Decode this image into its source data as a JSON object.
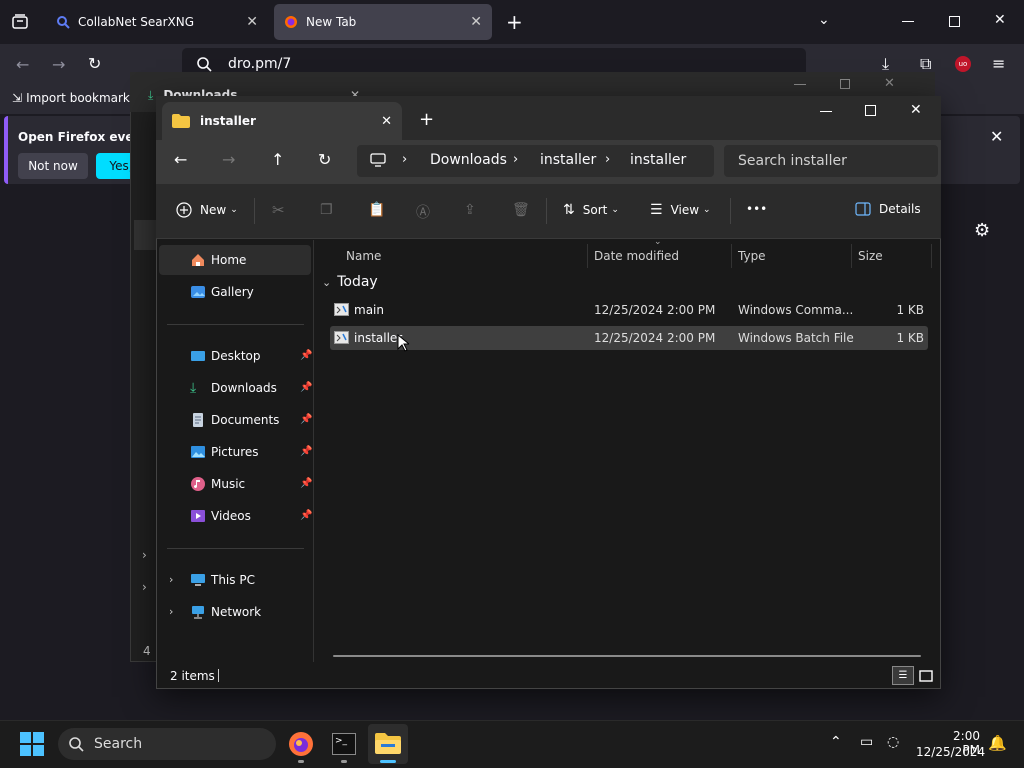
{
  "firefox": {
    "tabs": [
      {
        "label": "CollabNet SearXNG"
      },
      {
        "label": "New Tab"
      }
    ],
    "url": "dro.pm/7",
    "bookmarks": {
      "import_label": "Import bookmarks"
    },
    "notification": {
      "text": "Open Firefox every",
      "not_now": "Not now",
      "yes": "Yes,"
    },
    "side_text": "4"
  },
  "bg_window": {
    "tab_title": "Downloads"
  },
  "explorer": {
    "tab_title": "installer",
    "breadcrumb": [
      "Downloads",
      "installer",
      "installer"
    ],
    "search_placeholder": "Search installer",
    "toolbar": {
      "new": "New",
      "sort": "Sort",
      "view": "View",
      "more": "•••",
      "details": "Details"
    },
    "nav": {
      "home": "Home",
      "gallery": "Gallery",
      "desktop": "Desktop",
      "downloads": "Downloads",
      "documents": "Documents",
      "pictures": "Pictures",
      "music": "Music",
      "videos": "Videos",
      "this_pc": "This PC",
      "network": "Network"
    },
    "columns": {
      "name": "Name",
      "date": "Date modified",
      "type": "Type",
      "size": "Size"
    },
    "group": "Today",
    "files": [
      {
        "name": "main",
        "date": "12/25/2024 2:00 PM",
        "type": "Windows Comma...",
        "size": "1 KB"
      },
      {
        "name": "installer",
        "date": "12/25/2024 2:00 PM",
        "type": "Windows Batch File",
        "size": "1 KB"
      }
    ],
    "status": "2 items"
  },
  "taskbar": {
    "search": "Search",
    "time": "2:00 PM",
    "date": "12/25/2024"
  },
  "colors": {
    "accent": "#0078d4",
    "selection": "#3f3f3f",
    "firefox_button": "#00ddff"
  }
}
